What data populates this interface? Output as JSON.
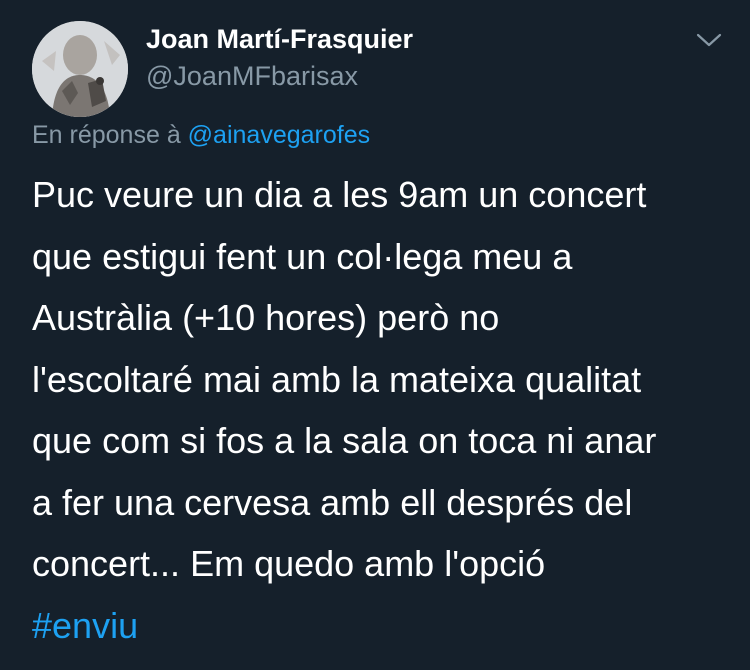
{
  "author": {
    "display_name": "Joan Martí-Frasquier",
    "handle": "@JoanMFbarisax"
  },
  "reply": {
    "prefix": "En réponse à",
    "mention": "@ainavegarofes"
  },
  "tweet": {
    "lines": [
      "Puc veure un dia a les 9am un concert",
      "que estigui fent un col·lega meu a",
      "Austràlia (+10 hores) però no",
      "l'escoltaré mai amb la mateixa qualitat",
      "que com si fos a la sala on toca ni anar",
      "a fer una cervesa amb ell després del",
      "concert... Em quedo amb l'opció"
    ],
    "hashtag": "#enviu"
  },
  "icons": {
    "menu": "chevron-down-icon"
  },
  "colors": {
    "background": "#15202b",
    "primary_text": "#ffffff",
    "secondary_text": "#8899a6",
    "link": "#1da1f2"
  }
}
